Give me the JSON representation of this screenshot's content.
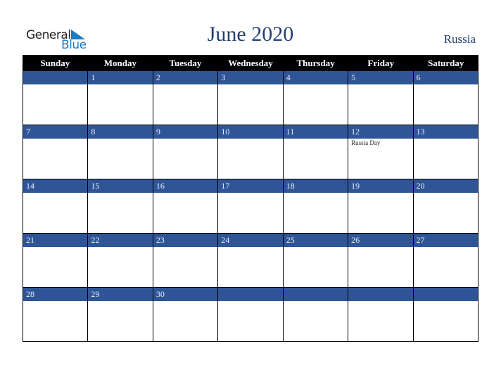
{
  "logo": {
    "line1": "General",
    "line2": "Blue"
  },
  "title": "June 2020",
  "country": "Russia",
  "weekdays": [
    "Sunday",
    "Monday",
    "Tuesday",
    "Wednesday",
    "Thursday",
    "Friday",
    "Saturday"
  ],
  "weeks": [
    [
      {
        "d": ""
      },
      {
        "d": "1"
      },
      {
        "d": "2"
      },
      {
        "d": "3"
      },
      {
        "d": "4"
      },
      {
        "d": "5"
      },
      {
        "d": "6"
      }
    ],
    [
      {
        "d": "7"
      },
      {
        "d": "8"
      },
      {
        "d": "9"
      },
      {
        "d": "10"
      },
      {
        "d": "11"
      },
      {
        "d": "12",
        "event": "Russia Day"
      },
      {
        "d": "13"
      }
    ],
    [
      {
        "d": "14"
      },
      {
        "d": "15"
      },
      {
        "d": "16"
      },
      {
        "d": "17"
      },
      {
        "d": "18"
      },
      {
        "d": "19"
      },
      {
        "d": "20"
      }
    ],
    [
      {
        "d": "21"
      },
      {
        "d": "22"
      },
      {
        "d": "23"
      },
      {
        "d": "24"
      },
      {
        "d": "25"
      },
      {
        "d": "26"
      },
      {
        "d": "27"
      }
    ],
    [
      {
        "d": "28"
      },
      {
        "d": "29"
      },
      {
        "d": "30"
      },
      {
        "d": ""
      },
      {
        "d": ""
      },
      {
        "d": ""
      },
      {
        "d": ""
      }
    ]
  ],
  "colors": {
    "header_bg": "#000000",
    "date_band": "#2f5597",
    "title": "#253f6e",
    "logo_blue": "#1a7bc4"
  }
}
